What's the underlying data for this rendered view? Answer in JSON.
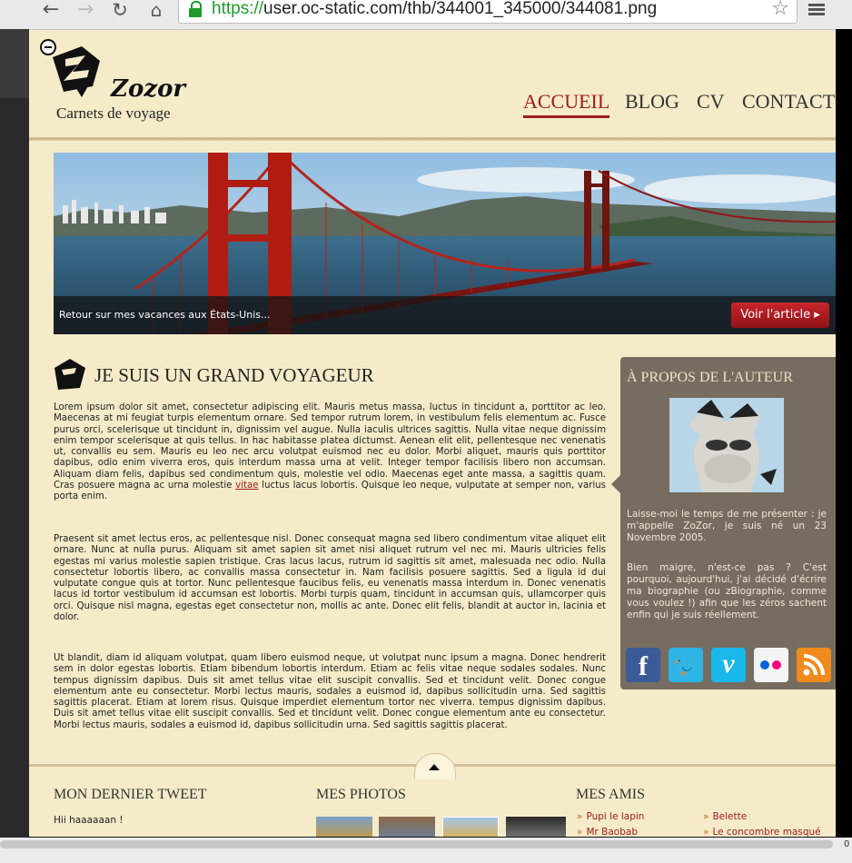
{
  "browser": {
    "url_scheme": "https://",
    "url_rest": "user.oc-static.com/thb/344001_345000/344081.png",
    "back_icon": "arrow-left-icon",
    "forward_icon": "arrow-right-icon",
    "reload_icon": "reload-icon",
    "home_icon": "home-icon",
    "lock_icon": "lock-icon",
    "star_icon": "star-icon",
    "menu_icon": "hamburger-icon"
  },
  "site": {
    "name": "Zozor",
    "tagline": "Carnets de voyage"
  },
  "nav": {
    "items": [
      "ACCUEIL",
      "BLOG",
      "CV",
      "CONTACT"
    ],
    "active": "ACCUEIL"
  },
  "hero": {
    "caption": "Retour sur mes vacances aux États-Unis...",
    "button": "Voir l'article ▸"
  },
  "article": {
    "title": "JE SUIS UN GRAND VOYAGEUR",
    "p1_before": "Lorem ipsum dolor sit amet, consectetur adipiscing elit. Mauris metus massa, luctus in tincidunt a, porttitor ac leo. Maecenas at mi feugiat turpis elementum ornare. Sed tempor rutrum lorem, in vestibulum felis elementum ac. Fusce purus orci, scelerisque ut tincidunt in, dignissim vel augue. Nulla iaculis ultrices sagittis. Nulla vitae neque dignissim enim tempor scelerisque at quis tellus. In hac habitasse platea dictumst. Aenean elit elit, pellentesque nec venenatis ut, convallis eu sem. Mauris eu leo nec arcu volutpat euismod nec eu dolor. Morbi aliquet, mauris quis porttitor dapibus, odio enim viverra eros, quis interdum massa urna at velit. Integer tempor facilisis libero non accumsan. Aliquam diam felis, dapibus sed condimentum quis, molestie vel odio. Maecenas eget ante massa, a sagittis quam. Cras posuere magna ac urna molestie ",
    "p1_link": "vitae",
    "p1_after": " luctus lacus lobortis. Quisque leo neque, vulputate at semper non, varius porta enim.",
    "p2": "Praesent sit amet lectus eros, ac pellentesque nisl. Donec consequat magna sed libero condimentum vitae aliquet elit ornare. Nunc at nulla purus. Aliquam sit amet sapien sit amet nisi aliquet rutrum vel nec mi. Mauris ultricies felis egestas mi varius molestie sapien tristique. Cras lacus lacus, rutrum id sagittis sit amet, malesuada nec odio. Nulla consectetur lobortis libero, ac convallis massa consectetur in. Nam facilisis posuere sagittis. Sed a ligula id dui vulputate congue quis at tortor. Nunc pellentesque faucibus felis, eu venenatis massa interdum in. Donec venenatis lacus id tortor vestibulum id accumsan est lobortis. Morbi turpis quam, tincidunt in accumsan quis, ullamcorper quis orci. Quisque nisl magna, egestas eget consectetur non, mollis ac ante. Donec elit felis, blandit at auctor in, lacinia et dolor.",
    "p3": "Ut blandit, diam id aliquam volutpat, quam libero euismod neque, ut volutpat nunc ipsum a magna. Donec hendrerit sem in dolor egestas lobortis. Etiam bibendum lobortis interdum. Etiam ac felis vitae neque sodales sodales. Nunc tempus dignissim dapibus. Duis sit amet tellus vitae elit suscipit convallis. Sed et tincidunt velit. Donec congue elementum ante eu consectetur. Morbi lectus mauris, sodales a euismod id, dapibus sollicitudin urna. Sed sagittis sagittis placerat. Etiam at lorem risus. Quisque imperdiet elementum tortor nec viverra. tempus dignissim dapibus. Duis sit amet tellus vitae elit suscipit convallis. Sed et tincidunt velit. Donec congue elementum ante eu consectetur. Morbi lectus mauris, sodales a euismod id, dapibus sollicitudin urna. Sed sagittis sagittis placerat."
  },
  "sidebar": {
    "title": "À PROPOS DE L'AUTEUR",
    "p1": "Laisse-moi le temps de me présenter : je m'appelle ZoZor, je suis né un 23 Novembre 2005.",
    "p2": "Bien maigre, n'est-ce pas ? C'est pourquoi, aujourd'hui, j'ai décidé d'écrire ma biographie (ou zBiographie, comme vous voulez !) afin que les zéros sachent enfin qui je suis réellement.",
    "socials": [
      {
        "icon": "facebook-icon",
        "glyph": "f"
      },
      {
        "icon": "twitter-icon",
        "glyph": "🐦"
      },
      {
        "icon": "vimeo-icon",
        "glyph": "v"
      },
      {
        "icon": "flickr-icon",
        "glyph": ""
      },
      {
        "icon": "rss-icon",
        "glyph": ""
      }
    ]
  },
  "footer": {
    "tweet_heading": "MON DERNIER TWEET",
    "tweet_text": "Hii haaaaaan !",
    "photos_heading": "MES PHOTOS",
    "friends_heading": "MES AMIS",
    "friends": [
      "Pupi le lapin",
      "Belette",
      "Mr Baobab",
      "Le concombre masqué"
    ]
  },
  "scrollbar": {
    "counter": "0"
  },
  "colors": {
    "accent": "#a01c1c",
    "page_bg": "#f5ebc9",
    "sidebar_bg": "#766c60"
  }
}
